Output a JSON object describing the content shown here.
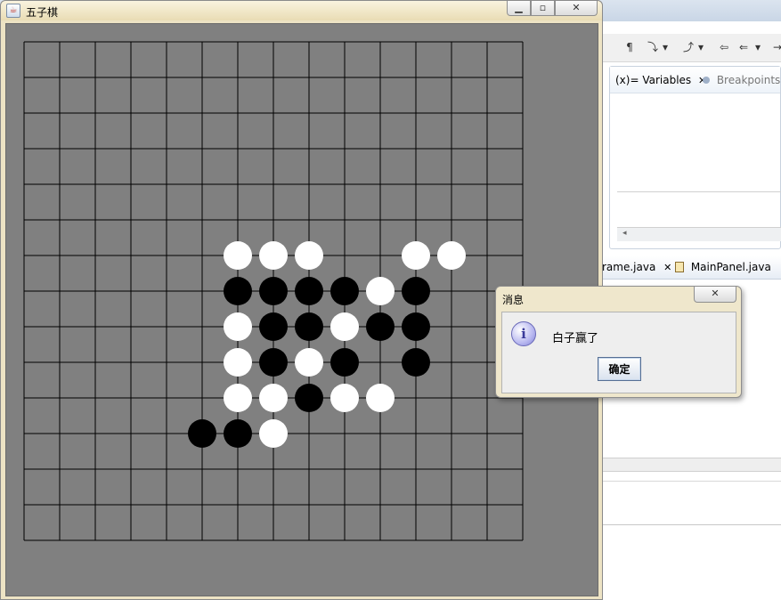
{
  "game_window": {
    "title": "五子棋",
    "min_glyph": "▁",
    "max_glyph": "▫",
    "close_glyph": "✕"
  },
  "board": {
    "lines": 15,
    "background": "#808080",
    "line_color": "#000000",
    "white_color": "#ffffff",
    "black_color": "#000000",
    "stones": [
      {
        "col": 6,
        "row": 6,
        "color": "white"
      },
      {
        "col": 7,
        "row": 6,
        "color": "white"
      },
      {
        "col": 8,
        "row": 6,
        "color": "white"
      },
      {
        "col": 11,
        "row": 6,
        "color": "white"
      },
      {
        "col": 12,
        "row": 6,
        "color": "white"
      },
      {
        "col": 6,
        "row": 7,
        "color": "black"
      },
      {
        "col": 7,
        "row": 7,
        "color": "black"
      },
      {
        "col": 8,
        "row": 7,
        "color": "black"
      },
      {
        "col": 9,
        "row": 7,
        "color": "black"
      },
      {
        "col": 10,
        "row": 7,
        "color": "white"
      },
      {
        "col": 11,
        "row": 7,
        "color": "black"
      },
      {
        "col": 6,
        "row": 8,
        "color": "white"
      },
      {
        "col": 7,
        "row": 8,
        "color": "black"
      },
      {
        "col": 8,
        "row": 8,
        "color": "black"
      },
      {
        "col": 9,
        "row": 8,
        "color": "white"
      },
      {
        "col": 10,
        "row": 8,
        "color": "black"
      },
      {
        "col": 11,
        "row": 8,
        "color": "black"
      },
      {
        "col": 6,
        "row": 9,
        "color": "white"
      },
      {
        "col": 7,
        "row": 9,
        "color": "black"
      },
      {
        "col": 8,
        "row": 9,
        "color": "white"
      },
      {
        "col": 9,
        "row": 9,
        "color": "black"
      },
      {
        "col": 11,
        "row": 9,
        "color": "black"
      },
      {
        "col": 6,
        "row": 10,
        "color": "white"
      },
      {
        "col": 7,
        "row": 10,
        "color": "white"
      },
      {
        "col": 8,
        "row": 10,
        "color": "black"
      },
      {
        "col": 9,
        "row": 10,
        "color": "white"
      },
      {
        "col": 10,
        "row": 10,
        "color": "white"
      },
      {
        "col": 5,
        "row": 11,
        "color": "black"
      },
      {
        "col": 6,
        "row": 11,
        "color": "black"
      },
      {
        "col": 7,
        "row": 11,
        "color": "white"
      }
    ]
  },
  "dialog": {
    "title": "消息",
    "message": "白子赢了",
    "ok_label": "确定",
    "close_glyph": "✕",
    "info_glyph": "i"
  },
  "ide": {
    "toolbar_icons": [
      "¶",
      "⤵",
      "▾",
      "⤴",
      "▾",
      "⇦",
      "⇐",
      "▾",
      "→"
    ],
    "views_tabs": [
      {
        "label": "(x)= Variables",
        "close": "✕",
        "active": true
      },
      {
        "label": "Breakpoints",
        "active": false
      }
    ],
    "editor_tabs": [
      {
        "label": "rame.java",
        "close": "✕"
      },
      {
        "label": "MainPanel.java"
      }
    ],
    "scroll_arrow": "◂"
  }
}
